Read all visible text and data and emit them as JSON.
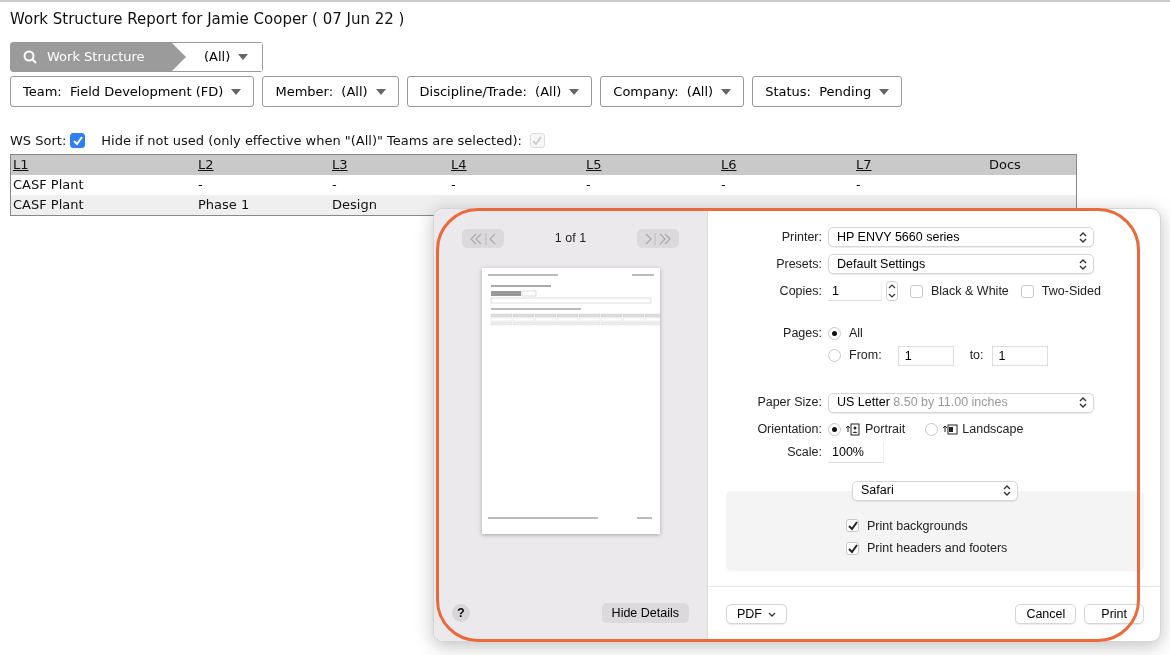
{
  "report": {
    "title": "Work Structure Report for Jamie Cooper ( 07 Jun 22 )",
    "search": {
      "label": "Work Structure",
      "value": "(All)"
    },
    "filters": [
      {
        "label": "Team:",
        "value": "Field Development (FD)"
      },
      {
        "label": "Member:",
        "value": "(All)"
      },
      {
        "label": "Discipline/Trade:",
        "value": "(All)"
      },
      {
        "label": "Company:",
        "value": "(All)"
      },
      {
        "label": "Status:",
        "value": "Pending"
      }
    ],
    "ws_sort": {
      "label": "WS Sort:",
      "checked": true
    },
    "hide_unused": {
      "label": "Hide if not used (only effective when \"(All)\" Teams are selected):",
      "checked": true,
      "disabled": true
    },
    "table": {
      "columns": [
        {
          "label": "L1",
          "sortable": true
        },
        {
          "label": "L2",
          "sortable": true
        },
        {
          "label": "L3",
          "sortable": true
        },
        {
          "label": "L4",
          "sortable": true
        },
        {
          "label": "L5",
          "sortable": true
        },
        {
          "label": "L6",
          "sortable": true
        },
        {
          "label": "L7",
          "sortable": true
        },
        {
          "label": "Docs",
          "sortable": false
        }
      ],
      "rows": [
        [
          "CASF Plant",
          "-",
          "-",
          "-",
          "-",
          "-",
          "-",
          ""
        ],
        [
          "CASF Plant",
          "Phase 1",
          "Design",
          "",
          "",
          "",
          "",
          ""
        ]
      ]
    }
  },
  "print_dialog": {
    "page_counter": "1 of 1",
    "printer": {
      "label": "Printer:",
      "value": "HP ENVY 5660 series"
    },
    "presets": {
      "label": "Presets:",
      "value": "Default Settings"
    },
    "copies": {
      "label": "Copies:",
      "value": "1",
      "options": [
        {
          "label": "Black & White",
          "checked": false
        },
        {
          "label": "Two-Sided",
          "checked": false
        }
      ]
    },
    "pages": {
      "label": "Pages:",
      "all": {
        "label": "All",
        "selected": true
      },
      "range": {
        "label": "From:",
        "selected": false,
        "from": "1",
        "to_label": "to:",
        "to": "1"
      }
    },
    "paper_size": {
      "label": "Paper Size:",
      "value": "US Letter",
      "detail": "8.50 by 11.00 inches"
    },
    "orientation": {
      "label": "Orientation:",
      "options": [
        {
          "label": "Portrait",
          "kind": "portrait",
          "selected": true
        },
        {
          "label": "Landscape",
          "kind": "landscape",
          "selected": false
        }
      ]
    },
    "scale": {
      "label": "Scale:",
      "value": "100%"
    },
    "app_menu": {
      "value": "Safari",
      "options": [
        {
          "label": "Print backgrounds",
          "checked": true
        },
        {
          "label": "Print headers and footers",
          "checked": true
        }
      ]
    },
    "help": "?",
    "hide_details": "Hide Details",
    "pdf": "PDF",
    "cancel": "Cancel",
    "print": "Print"
  },
  "annotation": {
    "highlight": true
  }
}
